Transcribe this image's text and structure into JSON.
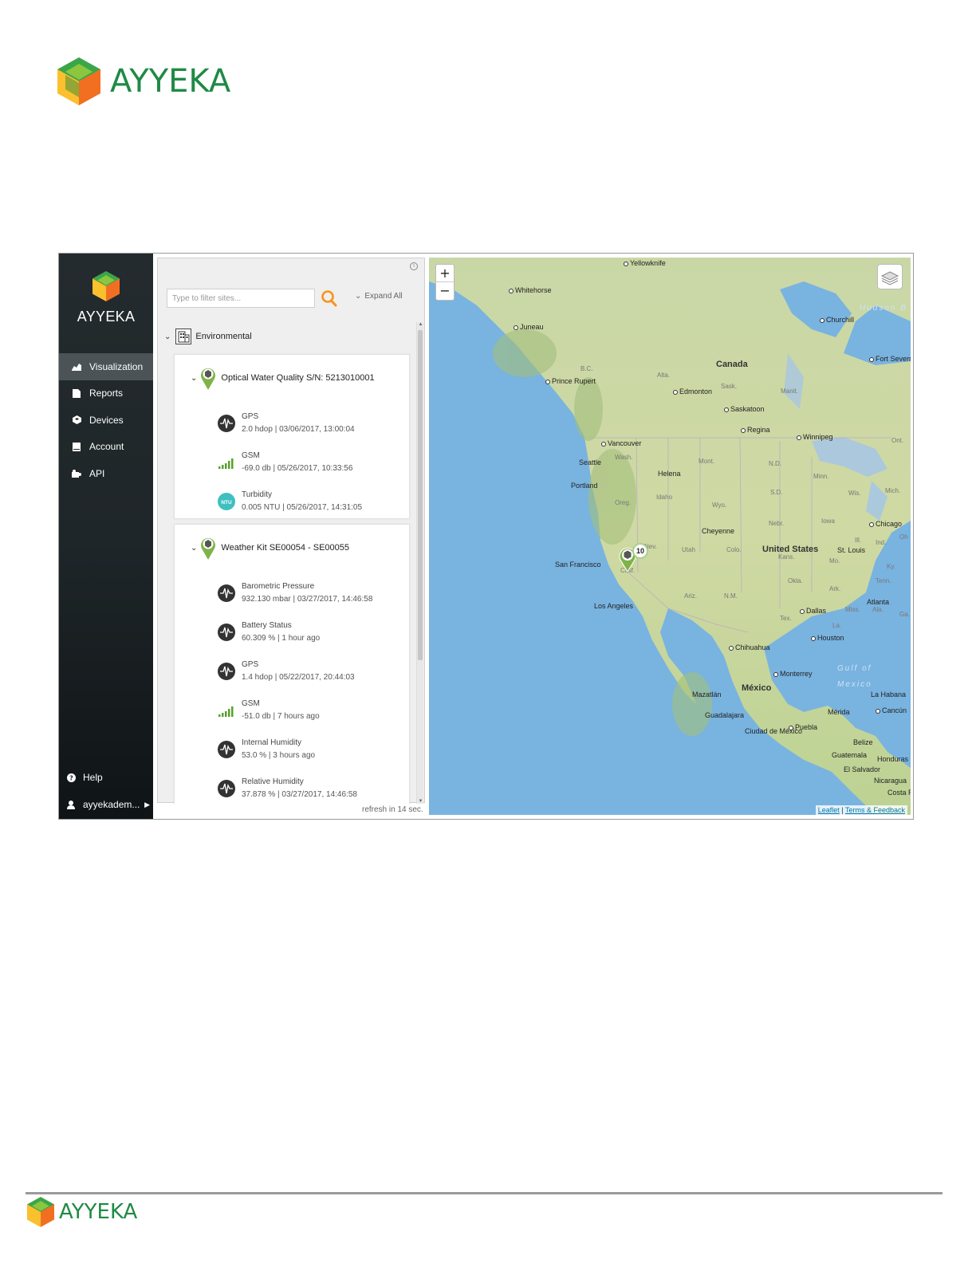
{
  "brand": {
    "name": "AYYEKA",
    "colors": {
      "green": "#1f8a45",
      "orange": "#f7941d",
      "yellow": "#fbc02d",
      "lime": "#8cc63f"
    }
  },
  "sidebar": {
    "logo_text": "AYYEKA",
    "items": [
      {
        "label": "Visualization",
        "icon": "chart-icon",
        "active": true
      },
      {
        "label": "Reports",
        "icon": "document-icon",
        "active": false
      },
      {
        "label": "Devices",
        "icon": "cube-icon",
        "active": false
      },
      {
        "label": "Account",
        "icon": "book-icon",
        "active": false
      },
      {
        "label": "API",
        "icon": "puzzle-icon",
        "active": false
      }
    ],
    "help_label": "Help",
    "user_label": "ayyekadem..."
  },
  "panel": {
    "filter_placeholder": "Type to filter sites...",
    "expand_all_label": "Expand All",
    "group_label": "Environmental",
    "refresh_text": "refresh in 14 sec.",
    "sites": [
      {
        "title": "Optical Water Quality S/N: 5213010001",
        "sensors": [
          {
            "name": "GPS",
            "value": "2.0 hdop | 03/06/2017, 13:00:04",
            "icon": "waveform-icon"
          },
          {
            "name": "GSM",
            "value": "-69.0 db | 05/26/2017, 10:33:56",
            "icon": "signal-bars-icon"
          },
          {
            "name": "Turbidity",
            "value": "0.005 NTU | 05/26/2017, 14:31:05",
            "icon": "ntu-icon",
            "badge": "NTU"
          }
        ]
      },
      {
        "title": "Weather Kit SE00054 - SE00055",
        "sensors": [
          {
            "name": "Barometric Pressure",
            "value": "932.130 mbar | 03/27/2017, 14:46:58",
            "icon": "waveform-icon"
          },
          {
            "name": "Battery Status",
            "value": "60.309 % | 1 hour ago",
            "icon": "waveform-icon"
          },
          {
            "name": "GPS",
            "value": "1.4 hdop | 05/22/2017, 20:44:03",
            "icon": "waveform-icon"
          },
          {
            "name": "GSM",
            "value": "-51.0 db | 7 hours ago",
            "icon": "signal-bars-icon"
          },
          {
            "name": "Internal Humidity",
            "value": "53.0 % | 3 hours ago",
            "icon": "waveform-icon"
          },
          {
            "name": "Relative Humidity",
            "value": "37.878 % | 03/27/2017, 14:46:58",
            "icon": "waveform-icon"
          }
        ]
      }
    ]
  },
  "map": {
    "zoom_in": "+",
    "zoom_out": "−",
    "cluster_count": "10",
    "attribution_leaflet": "Leaflet",
    "attribution_sep": " | ",
    "attribution_terms": "Terms & Feedback",
    "countries": [
      "Canada",
      "United States",
      "México"
    ],
    "cities": [
      "Yellowknife",
      "Whitehorse",
      "Juneau",
      "Churchill",
      "Prince Rupert",
      "Edmonton",
      "Saskatoon",
      "Regina",
      "Winnipeg",
      "Vancouver",
      "Seattle",
      "Helena",
      "Portland",
      "Cheyenne",
      "Chicago",
      "St. Louis",
      "San Francisco",
      "Los Angeles",
      "Atlanta",
      "Dallas",
      "Houston",
      "Chihuahua",
      "Monterrey",
      "Mazatlán",
      "Guadalajara",
      "Ciudad de México",
      "Puebla",
      "La Habana",
      "Mérida",
      "Cancún",
      "Belize",
      "Guatemala",
      "El Salvador",
      "Honduras",
      "Nicaragua",
      "Costa Rica",
      "Fort Severn"
    ],
    "regions": [
      "Alta.",
      "B.C.",
      "Sask.",
      "Manit.",
      "Ont.",
      "Wash.",
      "Mont.",
      "N.D.",
      "Minn.",
      "Oreg.",
      "Idaho",
      "Wyo.",
      "S.D.",
      "Wis.",
      "Mich.",
      "Nebr.",
      "Iowa",
      "Nev.",
      "Utah",
      "Colo.",
      "Kans.",
      "Mo.",
      "Ill.",
      "Ind.",
      "Ky.",
      "Tenn.",
      "Calif.",
      "Ariz.",
      "N.M.",
      "Okla.",
      "Ark.",
      "Tex.",
      "Miss.",
      "Ala.",
      "Ga.",
      "La.",
      "Oh"
    ],
    "seas": [
      "Hudson B",
      "Gulf of",
      "Mexico"
    ]
  }
}
